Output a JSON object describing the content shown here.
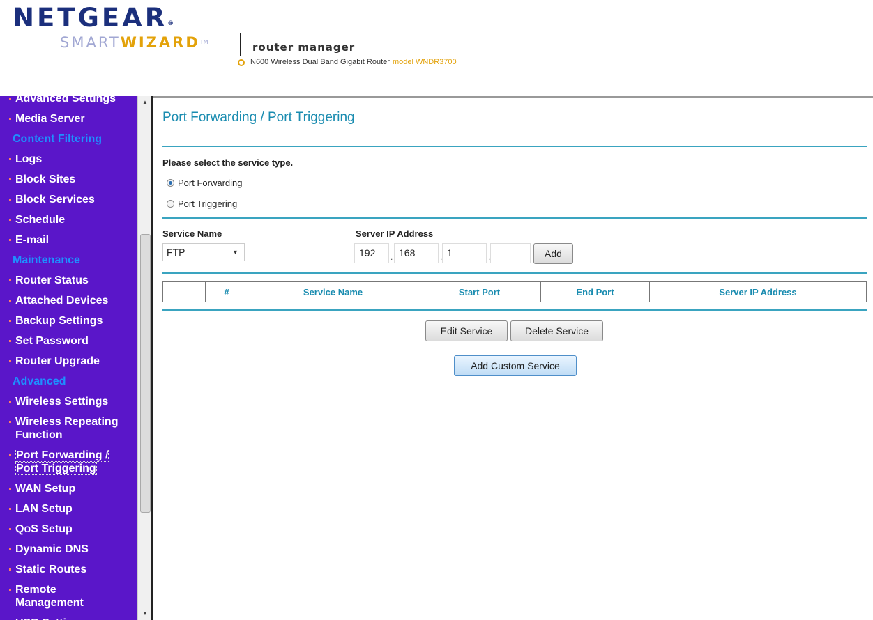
{
  "header": {
    "brand": "NETGEAR",
    "wizard_smart": "SMART",
    "wizard_bold": "WIZARD",
    "trademark": "TM",
    "app_title": "router manager",
    "device_name": "N600 Wireless Dual Band Gigabit Router",
    "model_label": "model WNDR3700"
  },
  "sidebar": {
    "items": [
      {
        "type": "item",
        "label": "Advanced Settings"
      },
      {
        "type": "item",
        "label": "Media Server"
      },
      {
        "type": "section",
        "label": "Content Filtering"
      },
      {
        "type": "item",
        "label": "Logs"
      },
      {
        "type": "item",
        "label": "Block Sites"
      },
      {
        "type": "item",
        "label": "Block Services"
      },
      {
        "type": "item",
        "label": "Schedule"
      },
      {
        "type": "item",
        "label": "E-mail"
      },
      {
        "type": "section",
        "label": "Maintenance"
      },
      {
        "type": "item",
        "label": "Router Status"
      },
      {
        "type": "item",
        "label": "Attached Devices"
      },
      {
        "type": "item",
        "label": "Backup Settings"
      },
      {
        "type": "item",
        "label": "Set Password"
      },
      {
        "type": "item",
        "label": "Router Upgrade"
      },
      {
        "type": "section",
        "label": "Advanced"
      },
      {
        "type": "item",
        "label": "Wireless Settings"
      },
      {
        "type": "item",
        "label": "Wireless Repeating Function",
        "lines": [
          "Wireless Repeating",
          "Function"
        ]
      },
      {
        "type": "item",
        "label": "Port Forwarding / Port Triggering",
        "lines": [
          "Port Forwarding /",
          "Port Triggering"
        ],
        "selected": true
      },
      {
        "type": "item",
        "label": "WAN Setup"
      },
      {
        "type": "item",
        "label": "LAN Setup"
      },
      {
        "type": "item",
        "label": "QoS Setup"
      },
      {
        "type": "item",
        "label": "Dynamic DNS"
      },
      {
        "type": "item",
        "label": "Static Routes"
      },
      {
        "type": "item",
        "label": "Remote Management",
        "lines": [
          "Remote",
          "Management"
        ]
      },
      {
        "type": "item",
        "label": "USB Settings"
      }
    ]
  },
  "main": {
    "title": "Port Forwarding / Port Triggering",
    "service_type_label": "Please select the service type.",
    "radio_forwarding": "Port Forwarding",
    "radio_triggering": "Port Triggering",
    "selected_service_type": "Port Forwarding",
    "service_name_label": "Service Name",
    "service_name_value": "FTP",
    "server_ip_label": "Server IP Address",
    "ip_octets": [
      "192",
      "168",
      "1",
      ""
    ],
    "add_button": "Add",
    "table_headers": [
      "",
      "#",
      "Service Name",
      "Start Port",
      "End Port",
      "Server IP Address"
    ],
    "edit_button": "Edit Service",
    "delete_button": "Delete Service",
    "add_custom_button": "Add Custom Service"
  },
  "colors": {
    "sidebar_bg": "#5a16c9",
    "section_text": "#1e90ff",
    "accent": "#1a8cb0",
    "brand": "#1b2f7c",
    "wizard_gold": "#e3a20a"
  }
}
